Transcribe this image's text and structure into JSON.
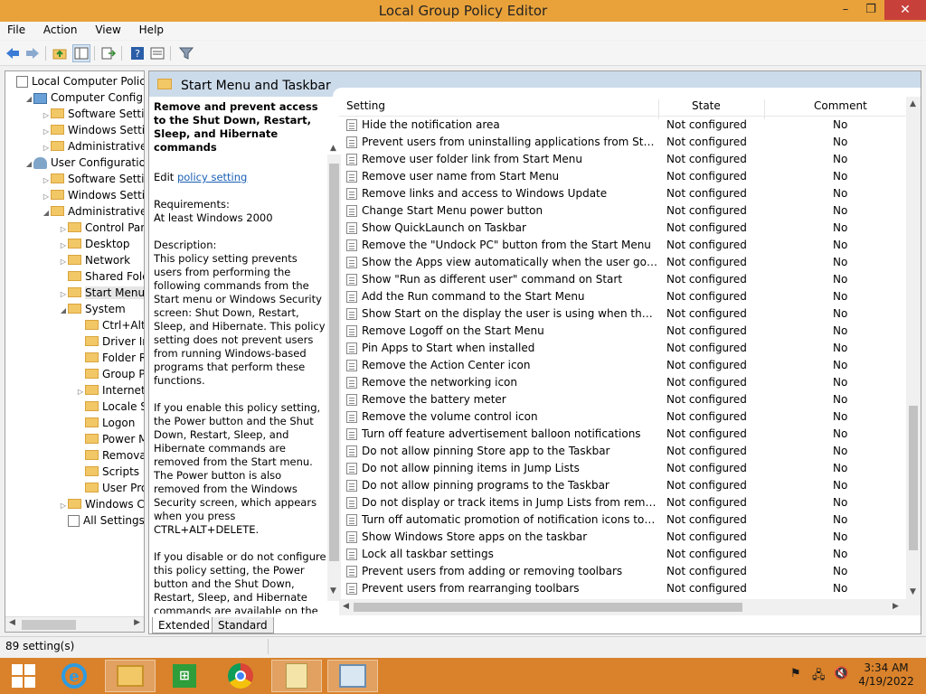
{
  "window": {
    "title": "Local Group Policy Editor",
    "min": "–",
    "max": "❐",
    "close": "✕"
  },
  "menu": [
    "File",
    "Action",
    "View",
    "Help"
  ],
  "tree": [
    {
      "label": "Local Computer Policy",
      "indent": 0,
      "exp": "",
      "icon": "doc"
    },
    {
      "label": "Computer Configuration",
      "indent": 1,
      "exp": "◢",
      "icon": "pc"
    },
    {
      "label": "Software Settings",
      "indent": 2,
      "exp": "▷",
      "icon": "fold"
    },
    {
      "label": "Windows Settings",
      "indent": 2,
      "exp": "▷",
      "icon": "fold"
    },
    {
      "label": "Administrative Templates",
      "indent": 2,
      "exp": "▷",
      "icon": "fold"
    },
    {
      "label": "User Configuration",
      "indent": 1,
      "exp": "◢",
      "icon": "ucfg"
    },
    {
      "label": "Software Settings",
      "indent": 2,
      "exp": "▷",
      "icon": "fold"
    },
    {
      "label": "Windows Settings",
      "indent": 2,
      "exp": "▷",
      "icon": "fold"
    },
    {
      "label": "Administrative Templates",
      "indent": 2,
      "exp": "◢",
      "icon": "fold"
    },
    {
      "label": "Control Panel",
      "indent": 3,
      "exp": "▷",
      "icon": "fold"
    },
    {
      "label": "Desktop",
      "indent": 3,
      "exp": "▷",
      "icon": "fold"
    },
    {
      "label": "Network",
      "indent": 3,
      "exp": "▷",
      "icon": "fold"
    },
    {
      "label": "Shared Folders",
      "indent": 3,
      "exp": "",
      "icon": "fold"
    },
    {
      "label": "Start Menu and Taskbar",
      "indent": 3,
      "exp": "▷",
      "icon": "fold",
      "selected": true
    },
    {
      "label": "System",
      "indent": 3,
      "exp": "◢",
      "icon": "fold"
    },
    {
      "label": "Ctrl+Alt+Del Options",
      "indent": 4,
      "exp": "",
      "icon": "fold"
    },
    {
      "label": "Driver Installation",
      "indent": 4,
      "exp": "",
      "icon": "fold"
    },
    {
      "label": "Folder Redirection",
      "indent": 4,
      "exp": "",
      "icon": "fold"
    },
    {
      "label": "Group Policy",
      "indent": 4,
      "exp": "",
      "icon": "fold"
    },
    {
      "label": "Internet Communication",
      "indent": 4,
      "exp": "▷",
      "icon": "fold"
    },
    {
      "label": "Locale Services",
      "indent": 4,
      "exp": "",
      "icon": "fold"
    },
    {
      "label": "Logon",
      "indent": 4,
      "exp": "",
      "icon": "fold"
    },
    {
      "label": "Power Management",
      "indent": 4,
      "exp": "",
      "icon": "fold"
    },
    {
      "label": "Removable Storage",
      "indent": 4,
      "exp": "",
      "icon": "fold"
    },
    {
      "label": "Scripts",
      "indent": 4,
      "exp": "",
      "icon": "fold"
    },
    {
      "label": "User Profiles",
      "indent": 4,
      "exp": "",
      "icon": "fold"
    },
    {
      "label": "Windows Components",
      "indent": 3,
      "exp": "▷",
      "icon": "fold"
    },
    {
      "label": "All Settings",
      "indent": 3,
      "exp": "",
      "icon": "doc"
    }
  ],
  "pane": {
    "title": "Start Menu and Taskbar",
    "desc_title": "Remove and prevent access to the Shut Down, Restart, Sleep, and Hibernate commands",
    "edit_prefix": "Edit ",
    "edit_link": "policy setting",
    "req_label": "Requirements:",
    "req_value": "At least Windows 2000",
    "desc_label": "Description:",
    "desc_p1": "This policy setting prevents users from performing the following commands from the Start menu or Windows Security screen: Shut Down, Restart, Sleep, and Hibernate. This policy setting does not prevent users from running Windows-based programs that perform these functions.",
    "desc_p2": "If you enable this policy setting, the Power button and the Shut Down, Restart, Sleep, and Hibernate commands are removed from the Start menu. The Power button is also removed from the Windows Security screen, which appears when you press CTRL+ALT+DELETE.",
    "desc_p3": "If you disable or do not configure this policy setting, the Power button and the Shut Down, Restart, Sleep, and Hibernate commands are available on the Start menu. The Power button on the Windows Security screen is also available."
  },
  "columns": {
    "setting": "Setting",
    "state": "State",
    "comment": "Comment"
  },
  "rows": [
    {
      "name": "Hide the notification area",
      "state": "Not configured",
      "comment": "No"
    },
    {
      "name": "Prevent users from uninstalling applications from Start",
      "state": "Not configured",
      "comment": "No"
    },
    {
      "name": "Remove user folder link from Start Menu",
      "state": "Not configured",
      "comment": "No"
    },
    {
      "name": "Remove user name from Start Menu",
      "state": "Not configured",
      "comment": "No"
    },
    {
      "name": "Remove links and access to Windows Update",
      "state": "Not configured",
      "comment": "No"
    },
    {
      "name": "Change Start Menu power button",
      "state": "Not configured",
      "comment": "No"
    },
    {
      "name": "Show QuickLaunch on Taskbar",
      "state": "Not configured",
      "comment": "No"
    },
    {
      "name": "Remove the \"Undock PC\" button from the Start Menu",
      "state": "Not configured",
      "comment": "No"
    },
    {
      "name": "Show the Apps view automatically when the user goes to St...",
      "state": "Not configured",
      "comment": "No"
    },
    {
      "name": "Show \"Run as different user\" command on Start",
      "state": "Not configured",
      "comment": "No"
    },
    {
      "name": "Add the Run command to the Start Menu",
      "state": "Not configured",
      "comment": "No"
    },
    {
      "name": "Show Start on the display the user is using when they press t...",
      "state": "Not configured",
      "comment": "No"
    },
    {
      "name": "Remove Logoff on the Start Menu",
      "state": "Not configured",
      "comment": "No"
    },
    {
      "name": "Pin Apps to Start when installed",
      "state": "Not configured",
      "comment": "No"
    },
    {
      "name": "Remove the Action Center icon",
      "state": "Not configured",
      "comment": "No"
    },
    {
      "name": "Remove the networking icon",
      "state": "Not configured",
      "comment": "No"
    },
    {
      "name": "Remove the battery meter",
      "state": "Not configured",
      "comment": "No"
    },
    {
      "name": "Remove the volume control icon",
      "state": "Not configured",
      "comment": "No"
    },
    {
      "name": "Turn off feature advertisement balloon notifications",
      "state": "Not configured",
      "comment": "No"
    },
    {
      "name": "Do not allow pinning Store app to the Taskbar",
      "state": "Not configured",
      "comment": "No"
    },
    {
      "name": "Do not allow pinning items in Jump Lists",
      "state": "Not configured",
      "comment": "No"
    },
    {
      "name": "Do not allow pinning programs to the Taskbar",
      "state": "Not configured",
      "comment": "No"
    },
    {
      "name": "Do not display or track items in Jump Lists from remote loca...",
      "state": "Not configured",
      "comment": "No"
    },
    {
      "name": "Turn off automatic promotion of notification icons to the ta...",
      "state": "Not configured",
      "comment": "No"
    },
    {
      "name": "Show Windows Store apps on the taskbar",
      "state": "Not configured",
      "comment": "No"
    },
    {
      "name": "Lock all taskbar settings",
      "state": "Not configured",
      "comment": "No"
    },
    {
      "name": "Prevent users from adding or removing toolbars",
      "state": "Not configured",
      "comment": "No"
    },
    {
      "name": "Prevent users from rearranging toolbars",
      "state": "Not configured",
      "comment": "No"
    }
  ],
  "tabs": {
    "extended": "Extended",
    "standard": "Standard"
  },
  "status": {
    "text": "89 setting(s)"
  },
  "clock": {
    "time": "3:34 AM",
    "date": "4/19/2022"
  },
  "taskbar_apps": [
    "start-icon",
    "ie-icon",
    "file-explorer-icon",
    "store-icon",
    "chrome-icon",
    "notepad-icon",
    "group-policy-editor-icon"
  ]
}
